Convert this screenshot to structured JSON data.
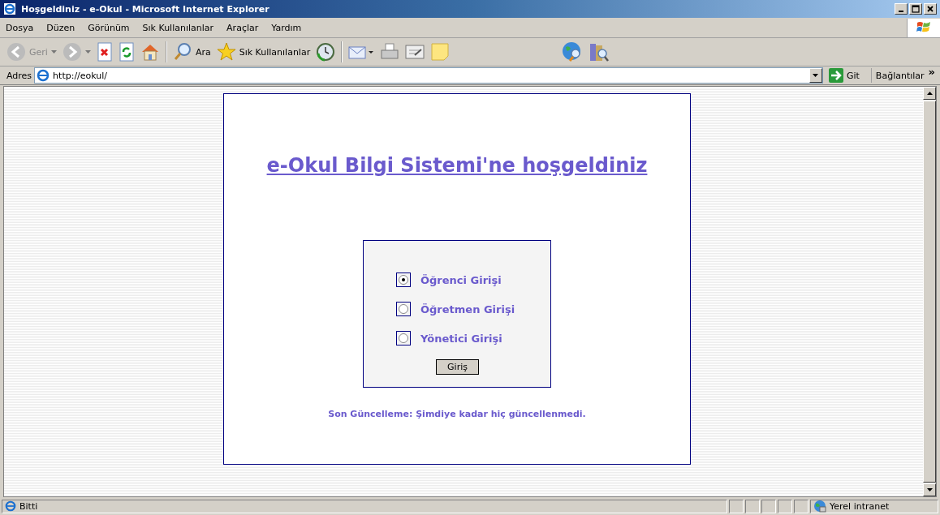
{
  "window": {
    "title": "Hoşgeldiniz - e-Okul  - Microsoft Internet Explorer"
  },
  "menu": [
    "Dosya",
    "Düzen",
    "Görünüm",
    "Sık Kullanılanlar",
    "Araçlar",
    "Yardım"
  ],
  "toolbar": [
    {
      "kind": "back",
      "label": "Geri"
    },
    {
      "kind": "forward"
    },
    {
      "kind": "stop"
    },
    {
      "kind": "refresh"
    },
    {
      "kind": "home"
    },
    {
      "kind": "search",
      "label": "Ara"
    },
    {
      "kind": "favorites",
      "label": "Sık Kullanılanlar"
    },
    {
      "kind": "history"
    },
    {
      "kind": "mail"
    },
    {
      "kind": "print"
    },
    {
      "kind": "edit"
    },
    {
      "kind": "note"
    },
    {
      "kind": "globe"
    },
    {
      "kind": "book"
    }
  ],
  "address_bar": {
    "label": "Adres",
    "url": "http://eokul/",
    "go": "Git",
    "links": "Bağlantılar",
    "more": "»"
  },
  "page": {
    "heading": "e-Okul Bilgi Sistemi'ne hoşgeldiniz",
    "options": [
      {
        "label": "Öğrenci Girişi",
        "selected": true
      },
      {
        "label": "Öğretmen Girişi",
        "selected": false
      },
      {
        "label": "Yönetici Girişi",
        "selected": false
      }
    ],
    "submit": "Giriş",
    "update_note": "Son Güncelleme: Şimdiye kadar hiç güncellenmedi."
  },
  "status_bar": {
    "text": "Bitti",
    "zone": "Yerel intranet"
  }
}
